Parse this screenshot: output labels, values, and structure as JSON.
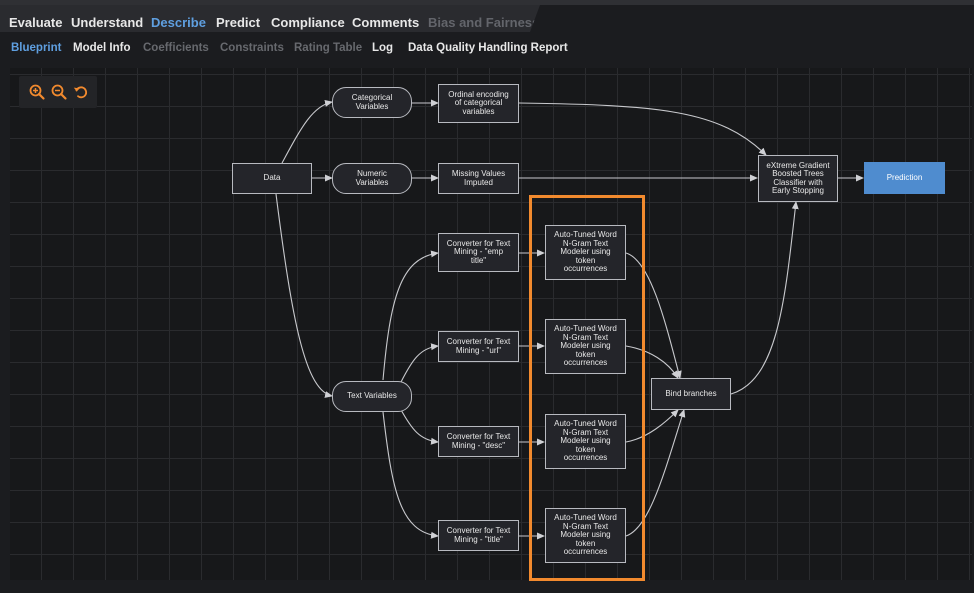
{
  "main_tabs": [
    {
      "label": "Evaluate",
      "state": "normal"
    },
    {
      "label": "Understand",
      "state": "normal"
    },
    {
      "label": "Describe",
      "state": "active"
    },
    {
      "label": "Predict",
      "state": "normal"
    },
    {
      "label": "Compliance",
      "state": "normal"
    },
    {
      "label": "Comments",
      "state": "normal"
    },
    {
      "label": "Bias and Fairness",
      "state": "disabled"
    }
  ],
  "sub_tabs": [
    {
      "label": "Blueprint",
      "state": "active"
    },
    {
      "label": "Model Info",
      "state": "normal"
    },
    {
      "label": "Coefficients",
      "state": "disabled"
    },
    {
      "label": "Constraints",
      "state": "disabled"
    },
    {
      "label": "Rating Table",
      "state": "disabled"
    },
    {
      "label": "Log",
      "state": "normal"
    },
    {
      "label": "Data Quality Handling Report",
      "state": "normal"
    }
  ],
  "zoom_controls": {
    "icons": [
      "zoom-in-icon",
      "zoom-out-icon",
      "reset-icon"
    ],
    "accent_color": "#f28a2e"
  },
  "blueprint": {
    "nodes": {
      "data": "Data",
      "categorical": "Categorical\nVariables",
      "numeric": "Numeric\nVariables",
      "text": "Text Variables",
      "ordinal": "Ordinal encoding\nof categorical\nvariables",
      "missing": "Missing Values\nImputed",
      "conv_emp": "Converter for Text\nMining - \"emp\ntitle\"",
      "conv_url": "Converter for Text\nMining - \"url\"",
      "conv_desc": "Converter for Text\nMining - \"desc\"",
      "conv_title": "Converter for Text\nMining - \"title\"",
      "ngram1": "Auto-Tuned Word\nN-Gram Text\nModeler using\ntoken\noccurrences",
      "ngram2": "Auto-Tuned Word\nN-Gram Text\nModeler using\ntoken\noccurrences",
      "ngram3": "Auto-Tuned Word\nN-Gram Text\nModeler using\ntoken\noccurrences",
      "ngram4": "Auto-Tuned Word\nN-Gram Text\nModeler using\ntoken\noccurrences",
      "bind": "Bind branches",
      "xgb": "eXtreme Gradient\nBoosted Trees\nClassifier with\nEarly Stopping",
      "prediction": "Prediction"
    },
    "prediction_color": "#4f8ccf",
    "highlight_color": "#f28a2e"
  }
}
